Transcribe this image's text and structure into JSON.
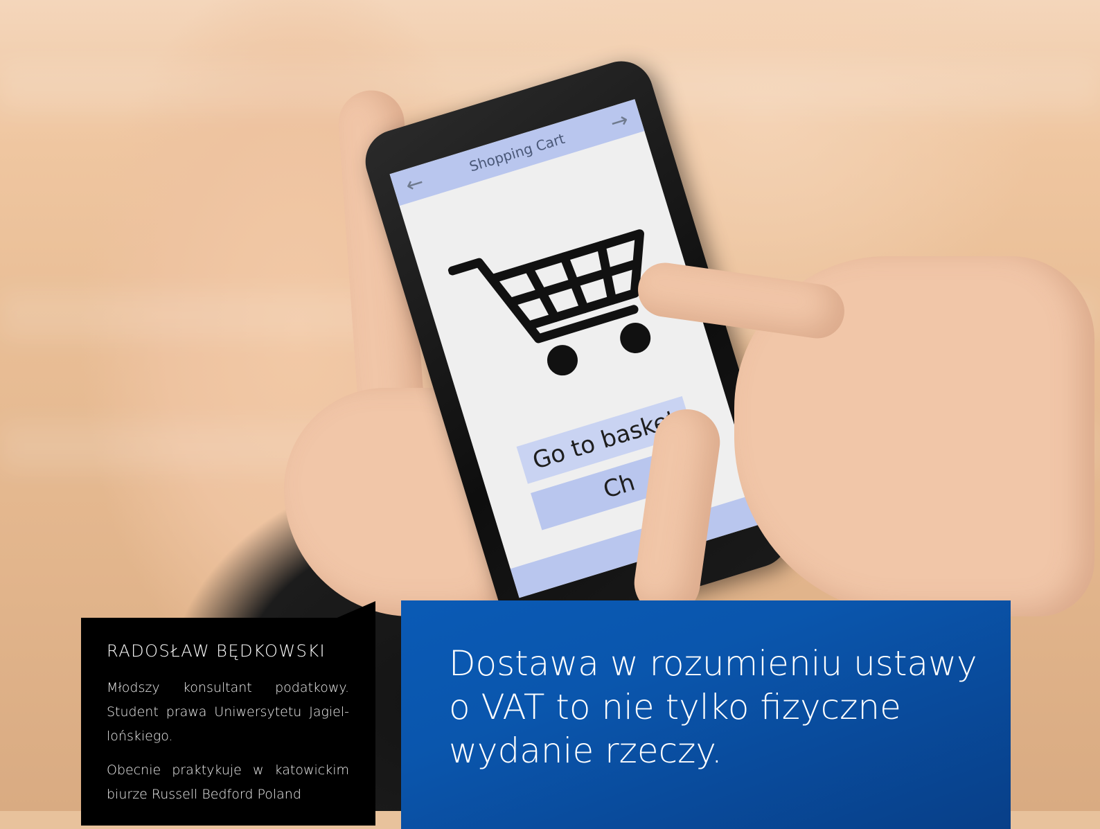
{
  "photo": {
    "screen_title": "Shopping Cart",
    "button_basket": "Go to basket",
    "button_checkout": "Ch",
    "colors": {
      "screen_bar": "#b9c6ee",
      "phone": "#111111",
      "skin": "#f1c6a8"
    }
  },
  "bio": {
    "name": "RADOSŁAW BĘDKOWSKI",
    "paragraph_1": "Młodszy konsultant podatkowy. Student prawa Uniwersytetu Jagiel­lońskiego.",
    "paragraph_2": "Obecnie praktykuje w katowic­kim biurze Russell Bedford Poland"
  },
  "quote": {
    "line_1": "Dostawa w rozumieniu ustawy",
    "line_2": "o VAT to nie tylko fizyczne",
    "line_3": "wydanie rzeczy."
  },
  "colors": {
    "quote_bg": "#0a56ad",
    "bio_bg": "#000000",
    "text": "#ffffff"
  }
}
